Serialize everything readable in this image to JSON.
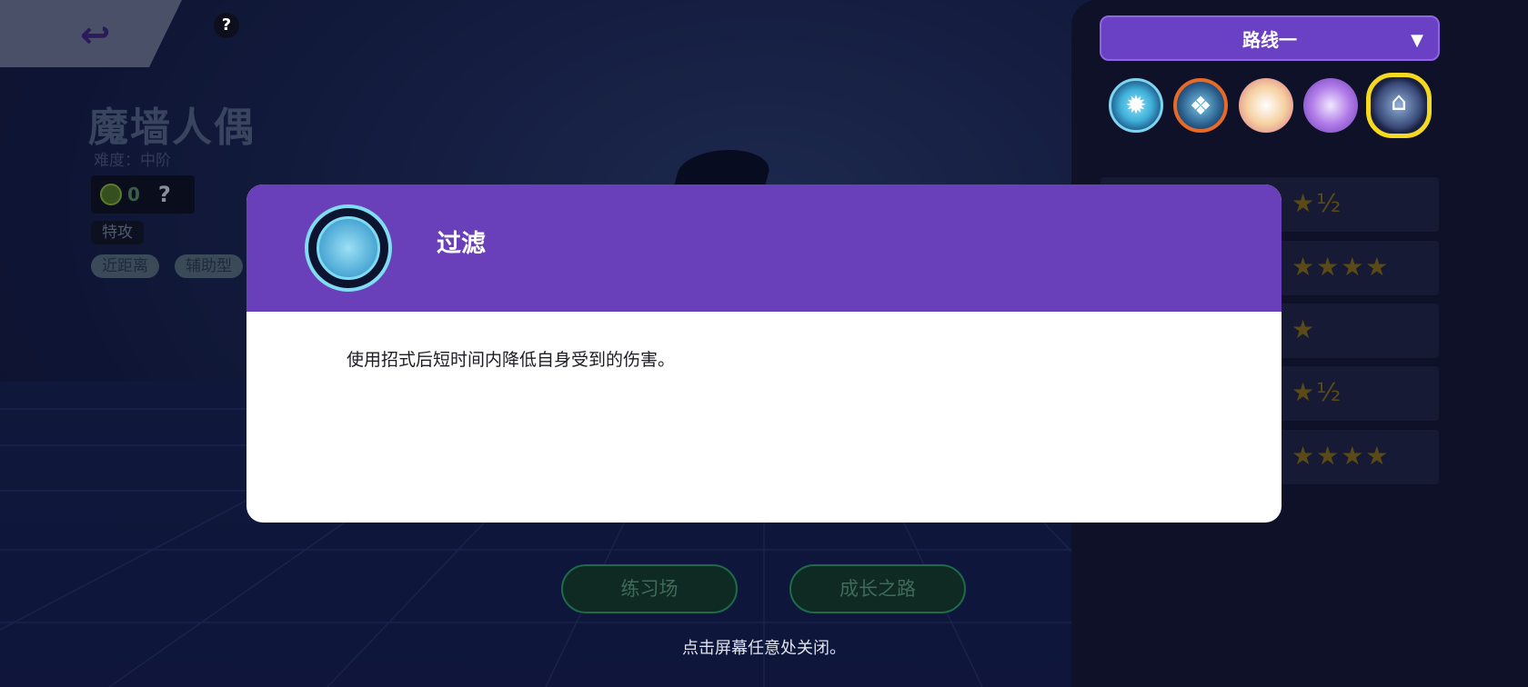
{
  "pokemon": {
    "name": "魔墙人偶",
    "difficulty": "难度：中阶",
    "emblem_count": "0",
    "role": "特攻",
    "range": "近距离",
    "type": "辅助型"
  },
  "top_bar": {
    "back_icon": "back-arrow-icon",
    "help_icon": "question-icon",
    "help_glyph": "?"
  },
  "right_panel": {
    "route_label": "路线一",
    "held_items": [
      "item-1",
      "item-2",
      "item-3",
      "item-4",
      "item-5"
    ],
    "stat_rows": [
      {
        "stars": "★½"
      },
      {
        "stars": "★★★★"
      },
      {
        "stars": "★"
      },
      {
        "stars": "★½"
      },
      {
        "stars": "★★★★"
      }
    ]
  },
  "bottom": {
    "practice_label": "练习场",
    "growth_label": "成长之路",
    "close_hint": "点击屏幕任意处关闭。"
  },
  "modal": {
    "title": "过滤",
    "description": "使用招式后短时间内降低自身受到的伤害。",
    "header_color": "#6a40ba"
  }
}
